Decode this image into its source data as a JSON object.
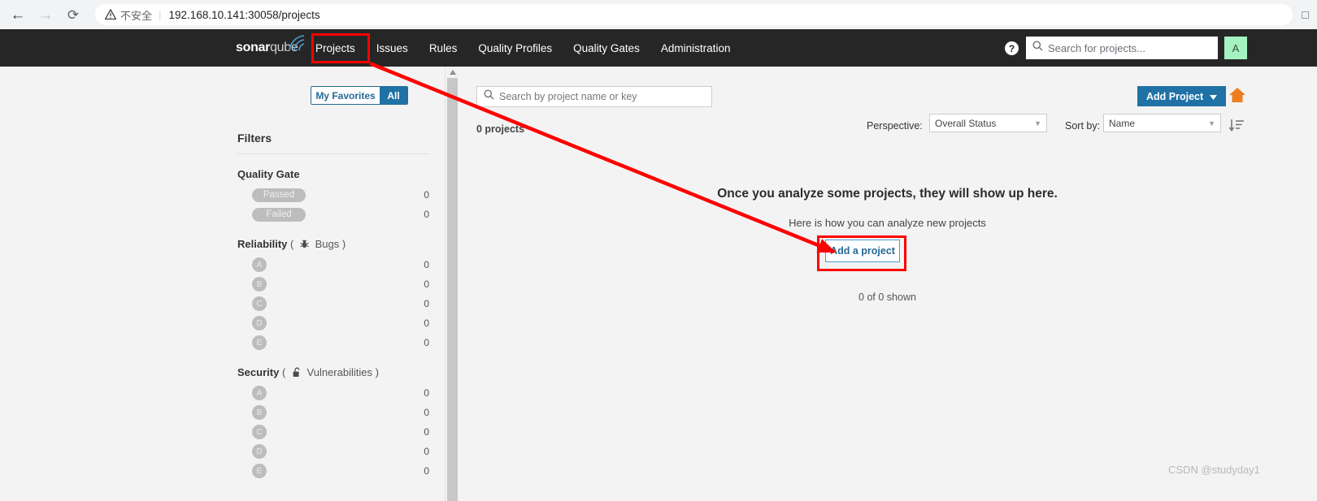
{
  "browser": {
    "back_icon": "arrow-left-icon",
    "forward_icon": "arrow-right-icon",
    "reload_icon": "reload-icon",
    "security_icon": "warning-triangle-icon",
    "security_label": "不安全",
    "url": "192.168.10.141:30058/projects"
  },
  "topnav": {
    "logo_bold": "sonar",
    "logo_light": "qube",
    "items": [
      {
        "label": "Projects",
        "active": true
      },
      {
        "label": "Issues",
        "active": false
      },
      {
        "label": "Rules",
        "active": false
      },
      {
        "label": "Quality Profiles",
        "active": false
      },
      {
        "label": "Quality Gates",
        "active": false
      },
      {
        "label": "Administration",
        "active": false
      }
    ],
    "help_icon": "help-question-icon",
    "search_icon": "search-icon",
    "search_placeholder": "Search for projects...",
    "avatar_initial": "A",
    "avatar_color": "#a4f2c0",
    "background": "#262626"
  },
  "sidebar": {
    "toggle": {
      "favorites_label": "My Favorites",
      "all_label": "All",
      "selected": "All"
    },
    "filters_title": "Filters",
    "facets": [
      {
        "name": "Quality Gate",
        "icon": null,
        "icon_label": null,
        "type": "gate",
        "rows": [
          {
            "label": "Passed",
            "count": "0"
          },
          {
            "label": "Failed",
            "count": "0"
          }
        ]
      },
      {
        "name": "Reliability",
        "icon": "bug-icon",
        "icon_label": "Bugs",
        "type": "rating",
        "rows": [
          {
            "label": "A",
            "count": "0"
          },
          {
            "label": "B",
            "count": "0"
          },
          {
            "label": "C",
            "count": "0"
          },
          {
            "label": "D",
            "count": "0"
          },
          {
            "label": "E",
            "count": "0"
          }
        ]
      },
      {
        "name": "Security",
        "icon": "unlocked-padlock-icon",
        "icon_label": "Vulnerabilities",
        "type": "rating",
        "rows": [
          {
            "label": "A",
            "count": "0"
          },
          {
            "label": "B",
            "count": "0"
          },
          {
            "label": "C",
            "count": "0"
          },
          {
            "label": "D",
            "count": "0"
          },
          {
            "label": "E",
            "count": "0"
          }
        ]
      }
    ]
  },
  "main": {
    "search_placeholder": "Search by project name or key",
    "search_icon": "search-icon",
    "project_count": "0 projects",
    "add_project_label": "Add Project",
    "add_project_caret": "▼",
    "home_icon": "home-icon",
    "sort_direction_icon": "sort-descending-icon",
    "perspective_label": "Perspective:",
    "perspective_value": "Overall Status",
    "sort_label": "Sort by:",
    "sort_value": "Name",
    "empty_heading": "Once you analyze some projects, they will show up here.",
    "empty_sub": "Here is how you can analyze new projects",
    "add_a_project_label": "Add a project",
    "shown_count": "0 of 0 shown"
  },
  "annotations": {
    "color": "#ff0000",
    "highlight_projects_nav": true,
    "highlight_add_a_project": true,
    "arrow_from": "Projects nav item",
    "arrow_to": "Add a project button"
  },
  "watermark": "CSDN @studyday1"
}
